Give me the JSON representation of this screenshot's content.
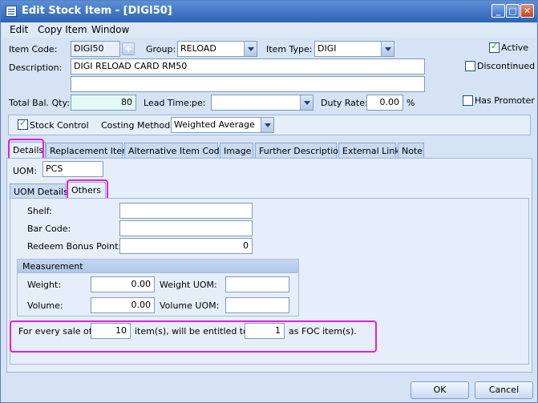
{
  "window": {
    "title": "Edit Stock Item - [DIGI50]"
  },
  "menu": [
    "Edit",
    "Copy Item",
    "Window"
  ],
  "form": {
    "item_code_label": "Item Code:",
    "item_code": "DIGI50",
    "group_label": "Group:",
    "group": "RELOAD",
    "item_type_label": "Item Type:",
    "item_type": "DIGI",
    "active_label": "Active",
    "discontinued_label": "Discontinued",
    "description_label": "Description:",
    "description": "DIGI RELOAD CARD RM50",
    "description2": "",
    "total_bal_qty_label": "Total Bal. Qty:",
    "total_bal_qty": "80",
    "lead_time_label": "Lead Time:",
    "lead_time_pe_label": "pe:",
    "lead_time_value": "",
    "duty_rate_label": "Duty Rate:",
    "duty_rate": "0.00",
    "duty_rate_unit": "%",
    "has_promoter_label": "Has Promoter",
    "stock_control_label": "Stock Control",
    "costing_method_label": "Costing Method:",
    "costing_method": "Weighted Average"
  },
  "tabs": [
    "Details",
    "Replacement Item",
    "Alternative Item Code",
    "Image",
    "Further Description",
    "External Link",
    "Note"
  ],
  "details": {
    "uom_label": "UOM:",
    "uom": "PCS",
    "subtabs": [
      "UOM Details",
      "Others"
    ],
    "shelf_label": "Shelf:",
    "shelf": "",
    "barcode_label": "Bar Code:",
    "barcode": "",
    "redeem_label": "Redeem Bonus Point:",
    "redeem": "0",
    "measurement_title": "Measurement",
    "weight_label": "Weight:",
    "weight": "0.00",
    "weight_uom_label": "Weight UOM:",
    "weight_uom": "",
    "volume_label": "Volume:",
    "volume": "0.00",
    "volume_uom_label": "Volume UOM:",
    "volume_uom": "",
    "foc_prefix": "For every sale of",
    "foc_sale_qty": "10",
    "foc_middle": "item(s), will be entitled to",
    "foc_qty": "1",
    "foc_suffix": "as FOC item(s)."
  },
  "buttons": {
    "ok": "OK",
    "cancel": "Cancel"
  },
  "colors": {
    "title_bar": "#2f63b5",
    "highlight": "#e020d8",
    "panel": "#e6eef9"
  }
}
